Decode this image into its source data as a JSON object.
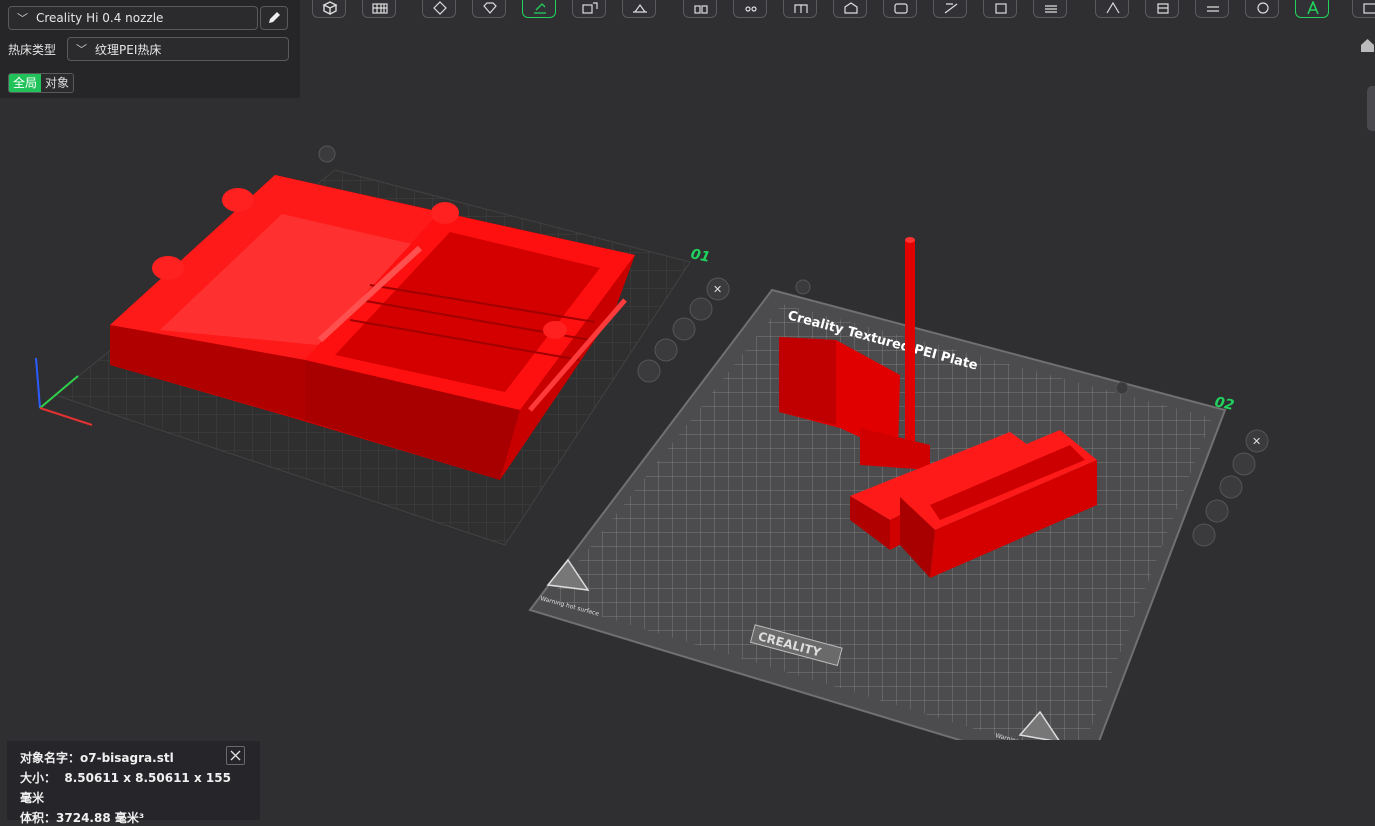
{
  "settings": {
    "printer": "Creality Hi 0.4 nozzle",
    "bed_label": "热床类型",
    "bed_type": "纹理PEI热床",
    "scope_global": "全局",
    "scope_object": "对象"
  },
  "plates": [
    {
      "number": "01"
    },
    {
      "number": "02",
      "bed_title": "Creality Textured PEI Plate",
      "brand": "CREALITY",
      "warning": "Warning hot surface"
    }
  ],
  "object_info": {
    "name_label": "对象名字：",
    "name": "o7-bisagra.stl",
    "size_label": "大小：",
    "size": "8.50611 x 8.50611 x 155",
    "unit": "毫米",
    "volume_label": "体积：",
    "volume": "3724.88 毫米³"
  },
  "colors": {
    "accent": "#21d25c",
    "model": "#e00000",
    "background": "#2f2f31",
    "plate": "#4a4a4c"
  },
  "toolbar_icons": [
    "cube-icon",
    "grid-icon",
    "move-icon",
    "rotate-icon",
    "layflat-icon",
    "split-icon",
    "cut-icon",
    "arrange-icon",
    "support-icon",
    "seam-icon",
    "measure-icon",
    "boolean-icon",
    "text-icon",
    "assembly-icon",
    "variable-layer-icon",
    "paint-icon",
    "hollow-icon",
    "scale-icon",
    "emboss-icon",
    "fuzzy-icon",
    "auto-icon",
    "screenshot-icon"
  ]
}
